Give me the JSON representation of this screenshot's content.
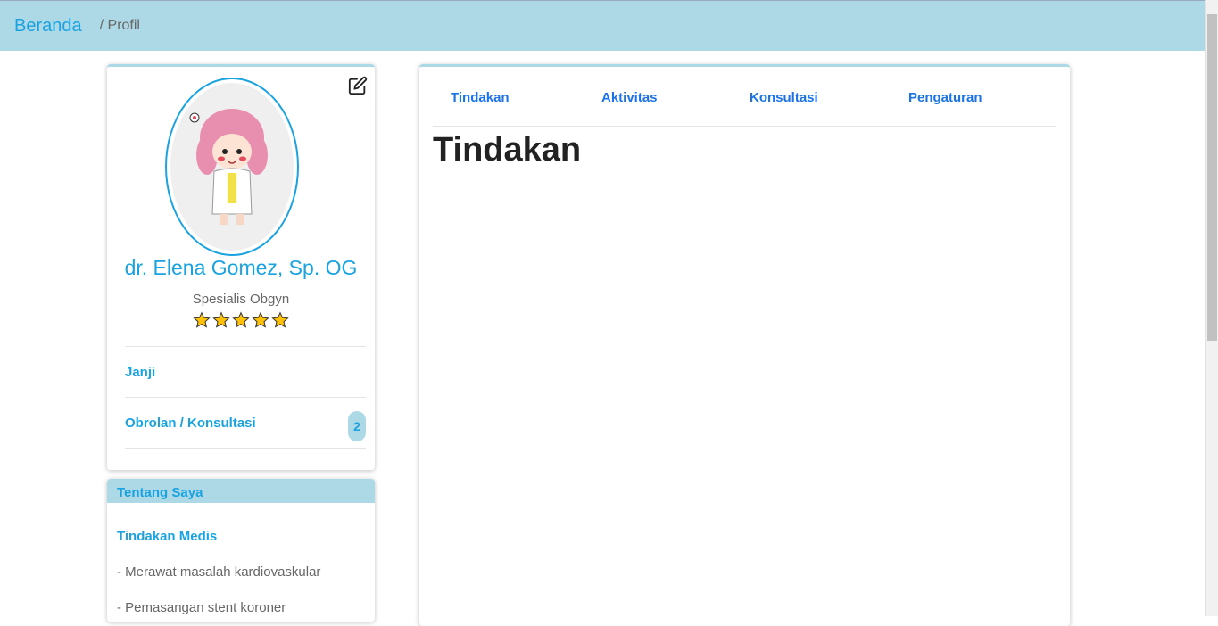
{
  "breadcrumb": {
    "home": "Beranda",
    "current": "/ Profil"
  },
  "profile": {
    "name": "dr. Elena Gomez, Sp. OG",
    "specialty": "Spesialis Obgyn",
    "rating": 5,
    "menu": {
      "appointments": "Janji",
      "chat": "Obrolan / Konsultasi",
      "chat_badge": "2"
    }
  },
  "about": {
    "title": "Tentang Saya",
    "subtitle": "Tindakan Medis",
    "items": [
      "- Merawat masalah kardiovaskular",
      "- Pemasangan stent koroner"
    ]
  },
  "tabs": [
    "Tindakan",
    "Aktivitas",
    "Konsultasi",
    "Pengaturan"
  ],
  "main": {
    "title": "Tindakan"
  },
  "colors": {
    "topbar": "#add8e6",
    "accent": "#1aa3e0",
    "tab": "#1a73e8",
    "star": "#ffc107"
  },
  "icons": {
    "edit": "edit-icon",
    "star": "star-icon",
    "avatar": "doctor-avatar"
  }
}
